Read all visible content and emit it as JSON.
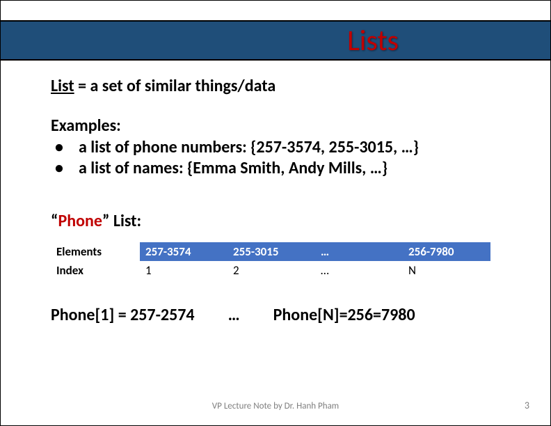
{
  "title": "Lists",
  "definition_term": "List",
  "definition_rest": " = a set of similar things/data",
  "examples_label": "Examples:",
  "examples": [
    "a list of phone numbers: {257-3574, 255-3015,  …}",
    "a list of names: {Emma Smith, Andy Mills, …}"
  ],
  "phone_list_quote_open": "“",
  "phone_list_word": "Phone",
  "phone_list_quote_close": "” List:",
  "table": {
    "row_labels": [
      "Elements",
      "Index"
    ],
    "elements": [
      "257-3574",
      "255-3015",
      "…",
      "256-7980"
    ],
    "index": [
      "1",
      "2",
      "…",
      "N"
    ]
  },
  "access": {
    "left": "Phone[1] = 257-2574",
    "mid": "…",
    "right": "Phone[N]=256=7980"
  },
  "footer": "VP Lecture Note by Dr. Hanh Pham",
  "page": "3"
}
